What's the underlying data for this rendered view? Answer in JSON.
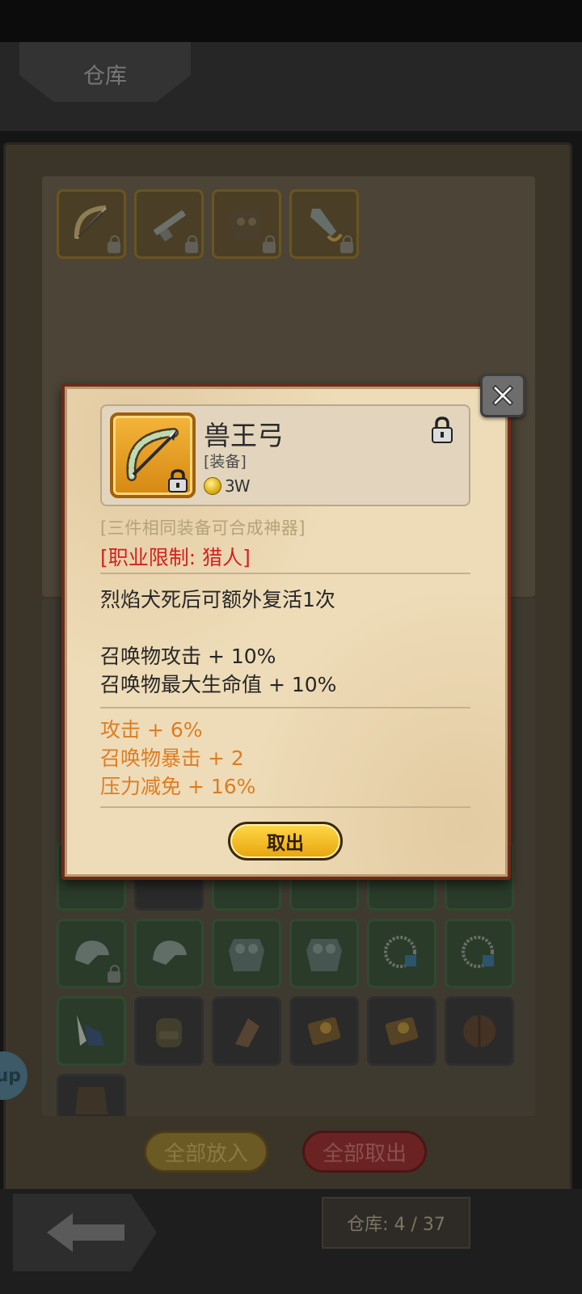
{
  "header": {
    "title": "仓库"
  },
  "equipped_slots": [
    {
      "icon": "bow-icon",
      "locked": true
    },
    {
      "icon": "rifle-icon",
      "locked": true
    },
    {
      "icon": "armor-icon",
      "locked": true
    },
    {
      "icon": "sword-icon",
      "locked": true
    }
  ],
  "inventory_rows": [
    [
      "helmet-icon",
      "helmet-icon",
      "chest-armor-icon",
      "chest-armor-icon",
      "necklace-icon",
      "necklace-icon"
    ],
    [
      "winged-boots-icon",
      "backpack-icon",
      "glove-icon",
      "spellbook-icon",
      "spellbook-icon",
      "round-shield-icon"
    ],
    [
      "fur-armor-icon"
    ]
  ],
  "footer": {
    "put_all_label": "全部放入",
    "take_all_label": "全部取出",
    "capacity_text": "仓库: 4 / 37",
    "side_button_label": "up"
  },
  "modal": {
    "item_name": "兽王弓",
    "item_category": "[装备]",
    "item_price": "3W",
    "item_icon": "bow-icon",
    "combine_hint": "[三件相同装备可合成神器]",
    "class_restriction": "[职业限制: 猎人]",
    "passive_desc": "烈焰犬死后可额外复活1次",
    "summon_stats": [
      "召唤物攻击 + 10%",
      "召唤物最大生命值 + 10%"
    ],
    "random_stats": [
      "攻击 + 6%",
      "召唤物暴击 + 2",
      "压力减免 + 16%"
    ],
    "take_out_label": "取出",
    "colors": {
      "restriction": "#d42020",
      "random_stat": "#dc7d24",
      "button_gold": "#f2bd25"
    }
  }
}
